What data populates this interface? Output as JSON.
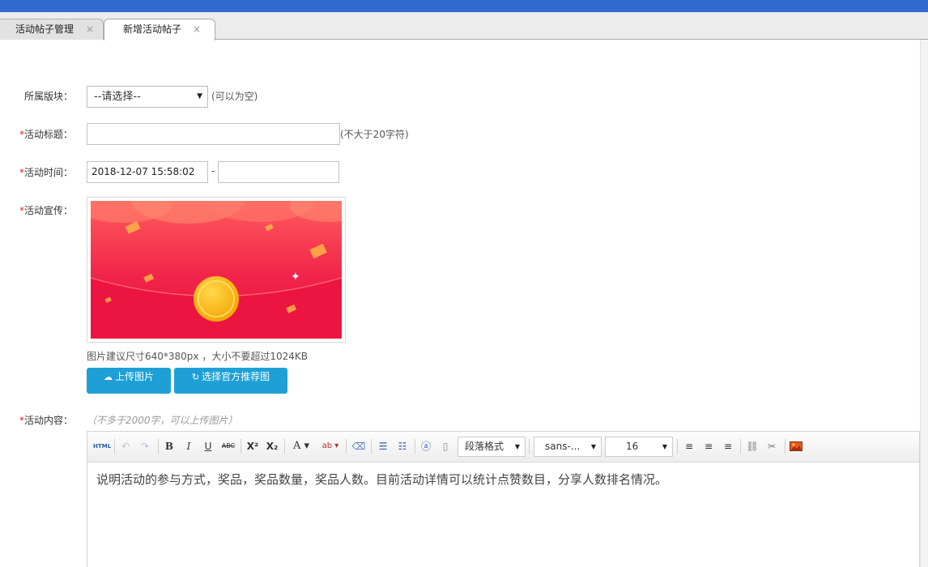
{
  "tabs": [
    {
      "label": "活动帖子管理",
      "close": "×"
    },
    {
      "label": "新增活动帖子",
      "close": "×"
    }
  ],
  "form": {
    "section": {
      "label": "所属版块：",
      "selected": "--请选择--",
      "hint": "(可以为空)"
    },
    "title": {
      "required": "*",
      "label": "活动标题：",
      "value": "",
      "hint": "(不大于20字符)"
    },
    "time": {
      "required": "*",
      "label": "活动时间：",
      "start": "2018-12-07 15:58:02",
      "separator": "-",
      "end": ""
    },
    "promo": {
      "required": "*",
      "label": "活动宣传：",
      "image_icon": "red-envelope-banner-image",
      "size_hint": "图片建议尺寸640*380px ，大小不要超过1024KB",
      "upload_label": "上传图片",
      "recommend_label": "选择官方推荐图"
    },
    "content": {
      "required": "*",
      "label": "活动内容：",
      "hint": "（不多于2000字，可以上传图片）"
    }
  },
  "editor": {
    "html_label": "HTML",
    "paragraph_format": "段落格式",
    "font_family": "sans-...",
    "font_size": "16",
    "text": "说明活动的参与方式，奖品，奖品数量，奖品人数。目前活动详情可以统计点赞数目，分享人数排名情况。"
  },
  "colors": {
    "topbar": "#2f6bcf",
    "button": "#1ea0d6",
    "required": "#e02020",
    "banner_red": "#f0244a",
    "coin": "#f5b800"
  }
}
